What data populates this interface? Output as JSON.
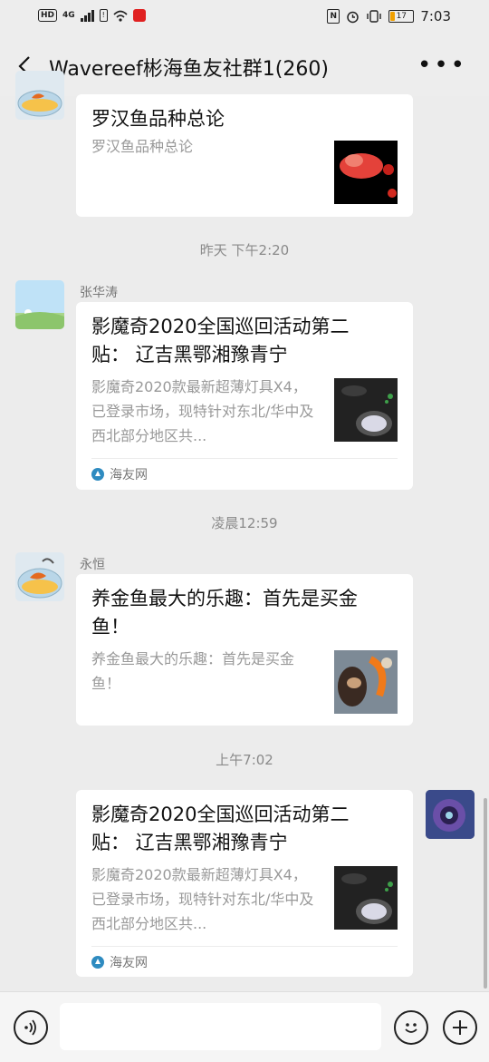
{
  "status_bar": {
    "left_badge": "HD",
    "network": "4G",
    "time": "7:03",
    "battery_level": "17"
  },
  "header": {
    "title": "Wavereef彬海鱼友社群1(260)",
    "back_icon": "chevron-left-icon",
    "more_icon": "more-dots-icon"
  },
  "messages": [
    {
      "title": "罗汉鱼品种总论",
      "desc": "罗汉鱼品种总论",
      "thumb": "flowerhorn-fish-image"
    },
    {
      "time": "昨天 下午2:20",
      "sender": "张华涛",
      "title": "影魔奇2020全国巡回活动第二贴： 辽吉黑鄂湘豫青宁",
      "desc": "影魔奇2020款最新超薄灯具X4，已登录市场，现特针对东北/华中及西北部分地区共...",
      "source": "海友网"
    },
    {
      "time": "凌晨12:59",
      "sender": "永恒",
      "title": "养金鱼最大的乐趣：首先是买金鱼！",
      "desc": "养金鱼最大的乐趣：首先是买金鱼！"
    },
    {
      "time": "上午7:02",
      "title": "影魔奇2020全国巡回活动第二贴： 辽吉黑鄂湘豫青宁",
      "desc": "影魔奇2020款最新超薄灯具X4，已登录市场，现特针对东北/华中及西北部分地区共...",
      "source": "海友网"
    }
  ],
  "input_bar": {
    "voice_icon": "voice-icon",
    "emoji_icon": "emoji-icon",
    "plus_icon": "plus-icon",
    "placeholder": ""
  },
  "colors": {
    "background": "#ececec",
    "bubble": "#ffffff",
    "muted_text": "#999999",
    "source_icon": "#2e8bc0"
  }
}
